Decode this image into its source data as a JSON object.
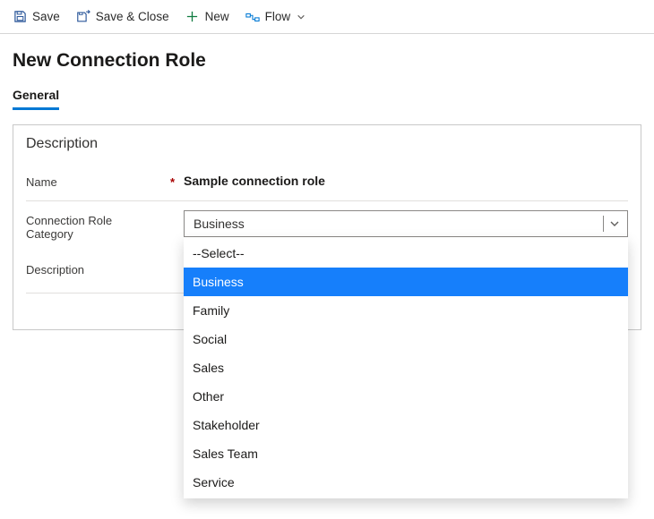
{
  "commandbar": {
    "save": "Save",
    "save_close": "Save & Close",
    "new": "New",
    "flow": "Flow"
  },
  "page": {
    "title": "New Connection Role"
  },
  "tabs": {
    "general": "General"
  },
  "section": {
    "title": "Description",
    "name_label": "Name",
    "name_value": "Sample connection role",
    "category_label": "Connection Role Category",
    "category_value": "Business",
    "description_label": "Description"
  },
  "category_options": [
    {
      "label": "--Select--",
      "highlight": false
    },
    {
      "label": "Business",
      "highlight": true
    },
    {
      "label": "Family",
      "highlight": false
    },
    {
      "label": "Social",
      "highlight": false
    },
    {
      "label": "Sales",
      "highlight": false
    },
    {
      "label": "Other",
      "highlight": false
    },
    {
      "label": "Stakeholder",
      "highlight": false
    },
    {
      "label": "Sales Team",
      "highlight": false
    },
    {
      "label": "Service",
      "highlight": false
    }
  ]
}
